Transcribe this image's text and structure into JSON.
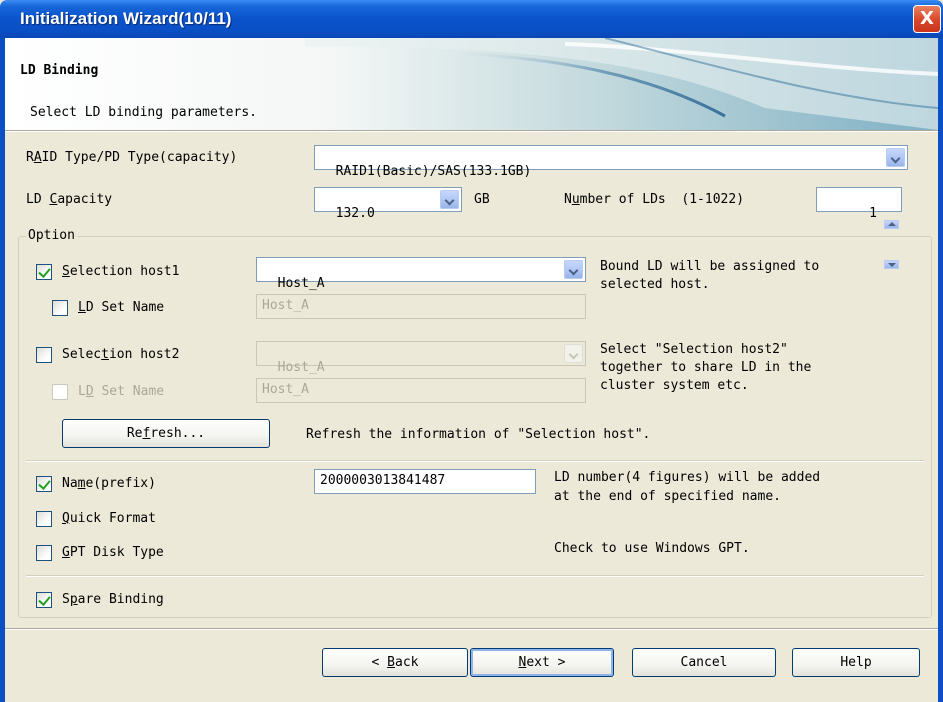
{
  "window": {
    "title": "Initialization Wizard(10/11)",
    "close_label": "X"
  },
  "header": {
    "title": "LD Binding",
    "subtitle": "Select LD binding parameters."
  },
  "raid": {
    "label_pre": "R",
    "label_u": "A",
    "label_post": "ID Type/PD Type(capacity)",
    "value": "RAID1(Basic)/SAS(133.1GB)"
  },
  "capacity": {
    "label_pre": "LD ",
    "label_u": "C",
    "label_post": "apacity",
    "value": "132.0",
    "unit": "GB"
  },
  "num_lds": {
    "label_pre": "N",
    "label_u": "u",
    "label_post": "mber of LDs  (1-1022)",
    "value": "1"
  },
  "option": {
    "legend": "Option",
    "host1": {
      "label_u": "S",
      "label_post": "election host1",
      "checked": true,
      "value": "Host_A",
      "set_name_u": "L",
      "set_name_post": "D Set Name",
      "set_name_value": "Host_A",
      "note": "Bound LD will be assigned to\nselected host."
    },
    "host2": {
      "label_pre": "Selec",
      "label_u": "t",
      "label_post": "ion host2",
      "checked": false,
      "value": "Host_A",
      "set_name_pre": "L",
      "set_name_u": "D",
      "set_name_post": " Set Name",
      "set_name_value": "Host_A",
      "note": "Select \"Selection host2\"\ntogether to share LD in the\ncluster system etc."
    },
    "refresh": {
      "label_pre": "Re",
      "label_u": "f",
      "label_post": "resh...",
      "note": "Refresh the information of \"Selection host\"."
    },
    "name_prefix": {
      "label_pre": "Na",
      "label_u": "m",
      "label_post": "e(prefix)",
      "checked": true,
      "value": "2000003013841487",
      "note": "LD number(4 figures) will be added\nat the end of specified name."
    },
    "quick_format": {
      "label_u": "Q",
      "label_post": "uick Format",
      "checked": false
    },
    "gpt": {
      "label_u": "G",
      "label_post": "PT Disk Type",
      "checked": false,
      "note": "Check to use Windows GPT."
    },
    "spare": {
      "label_pre": "S",
      "label_u": "p",
      "label_post": "are Binding",
      "checked": true
    }
  },
  "buttons": {
    "back": {
      "pre": "< ",
      "u": "B",
      "post": "ack"
    },
    "next": {
      "u": "N",
      "post": "ext >"
    },
    "cancel": "Cancel",
    "help": "Help"
  },
  "colors": {
    "titlebar": "#0a53cc",
    "dialog_bg": "#ece9d8",
    "check": "#21a121",
    "close": "#d9462a"
  }
}
